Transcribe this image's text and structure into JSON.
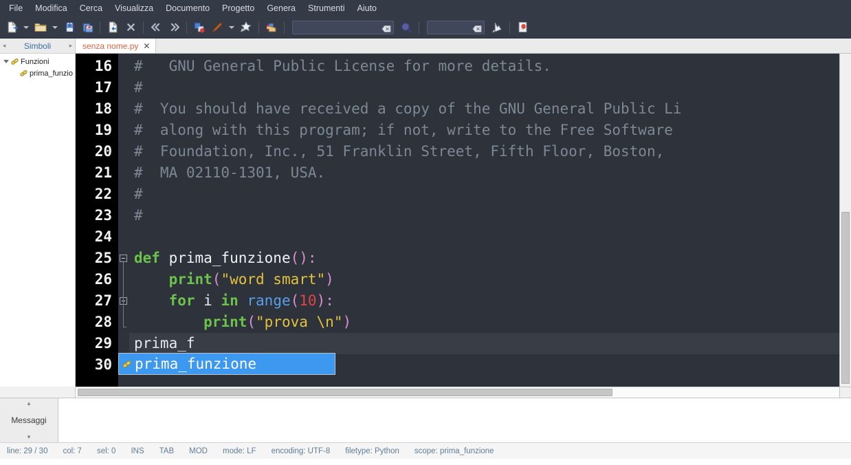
{
  "menubar": {
    "items": [
      {
        "label": "File",
        "name": "menu-file"
      },
      {
        "label": "Modifica",
        "name": "menu-modifica"
      },
      {
        "label": "Cerca",
        "name": "menu-cerca"
      },
      {
        "label": "Visualizza",
        "name": "menu-visualizza"
      },
      {
        "label": "Documento",
        "name": "menu-documento"
      },
      {
        "label": "Progetto",
        "name": "menu-progetto"
      },
      {
        "label": "Genera",
        "name": "menu-genera"
      },
      {
        "label": "Strumenti",
        "name": "menu-strumenti"
      },
      {
        "label": "Aiuto",
        "name": "menu-aiuto"
      }
    ]
  },
  "toolbar": {
    "buttons": [
      {
        "name": "new-file-icon",
        "glyph": "new"
      },
      {
        "name": "new-file-dropdown-icon",
        "glyph": "caret"
      },
      {
        "name": "open-folder-icon",
        "glyph": "folder"
      },
      {
        "name": "open-recent-dropdown-icon",
        "glyph": "caret"
      },
      {
        "name": "save-icon",
        "glyph": "save"
      },
      {
        "name": "save-all-icon",
        "glyph": "saveall"
      },
      {
        "name": "separator",
        "glyph": "sep"
      },
      {
        "name": "reload-file-icon",
        "glyph": "reload"
      },
      {
        "name": "close-file-icon",
        "glyph": "close"
      },
      {
        "name": "separator",
        "glyph": "sep"
      },
      {
        "name": "navigate-back-icon",
        "glyph": "back"
      },
      {
        "name": "navigate-forward-icon",
        "glyph": "forward"
      },
      {
        "name": "separator",
        "glyph": "sep"
      },
      {
        "name": "compile-icon",
        "glyph": "compile"
      },
      {
        "name": "build-icon",
        "glyph": "build"
      },
      {
        "name": "build-dropdown-icon",
        "glyph": "caret"
      },
      {
        "name": "run-icon",
        "glyph": "run"
      },
      {
        "name": "separator",
        "glyph": "sep"
      },
      {
        "name": "color-scheme-icon",
        "glyph": "colors"
      },
      {
        "name": "separator",
        "glyph": "sep"
      }
    ],
    "search": {
      "value": "",
      "placeholder": ""
    },
    "goto": {
      "value": "",
      "placeholder": ""
    },
    "search_icon_name": "search-magnifier-icon",
    "jump-to-icon": "jump-to-icon",
    "quit-icon": "quit-icon"
  },
  "sidebar": {
    "tab_label": "Simboli",
    "nav_prev": "◂",
    "nav_next": "▸",
    "tree": [
      {
        "label": "Funzioni",
        "level": 0,
        "expanded": true,
        "name": "tree-item-funzioni"
      },
      {
        "label": "prima_funzio",
        "level": 1,
        "expanded": false,
        "name": "tree-item-prima-funzione"
      }
    ]
  },
  "editor": {
    "tab": {
      "filename": "senza nome.py",
      "close": "✕",
      "modified_color": "#e8603c"
    },
    "lines": [
      {
        "num": "16",
        "tokens": [
          {
            "t": "#   GNU General Public License for more details.",
            "c": "cm"
          }
        ]
      },
      {
        "num": "17",
        "tokens": [
          {
            "t": "#",
            "c": "cm"
          }
        ]
      },
      {
        "num": "18",
        "tokens": [
          {
            "t": "#  You should have received a copy of the GNU General Public Li",
            "c": "cm"
          }
        ]
      },
      {
        "num": "19",
        "tokens": [
          {
            "t": "#  along with this program; if not, write to the Free Software",
            "c": "cm"
          }
        ]
      },
      {
        "num": "20",
        "tokens": [
          {
            "t": "#  Foundation, Inc., 51 Franklin Street, Fifth Floor, Boston,",
            "c": "cm"
          }
        ]
      },
      {
        "num": "21",
        "tokens": [
          {
            "t": "#  MA 02110-1301, USA.",
            "c": "cm"
          }
        ]
      },
      {
        "num": "22",
        "tokens": [
          {
            "t": "#",
            "c": "cm"
          }
        ]
      },
      {
        "num": "23",
        "tokens": [
          {
            "t": "#",
            "c": "cm"
          }
        ]
      },
      {
        "num": "24",
        "tokens": []
      },
      {
        "num": "25",
        "fold": "open",
        "tokens": [
          {
            "t": "def ",
            "c": "kw"
          },
          {
            "t": "prima_funzione",
            "c": "fnname"
          },
          {
            "t": "():",
            "c": "paren"
          }
        ]
      },
      {
        "num": "26",
        "tokens": [
          {
            "t": "    ",
            "c": "plain"
          },
          {
            "t": "print",
            "c": "kw"
          },
          {
            "t": "(",
            "c": "paren"
          },
          {
            "t": "\"word smart\"",
            "c": "str"
          },
          {
            "t": ")",
            "c": "paren"
          }
        ]
      },
      {
        "num": "27",
        "fold": "open",
        "tokens": [
          {
            "t": "    ",
            "c": "plain"
          },
          {
            "t": "for ",
            "c": "kw"
          },
          {
            "t": "i ",
            "c": "plain"
          },
          {
            "t": "in ",
            "c": "kw"
          },
          {
            "t": "range",
            "c": "bi"
          },
          {
            "t": "(",
            "c": "paren"
          },
          {
            "t": "10",
            "c": "num"
          },
          {
            "t": "):",
            "c": "paren"
          }
        ]
      },
      {
        "num": "28",
        "tokens": [
          {
            "t": "        ",
            "c": "plain"
          },
          {
            "t": "print",
            "c": "kw"
          },
          {
            "t": "(",
            "c": "paren"
          },
          {
            "t": "\"prova \\n\"",
            "c": "str"
          },
          {
            "t": ")",
            "c": "paren"
          }
        ]
      },
      {
        "num": "29",
        "current": true,
        "tokens": [
          {
            "t": "prima_f",
            "c": "plain"
          }
        ]
      },
      {
        "num": "30",
        "tokens": []
      }
    ],
    "autocomplete": {
      "visible": true,
      "selected": "prima_funzione",
      "icon_name": "function-symbol-icon",
      "bg": "#3d98f0"
    }
  },
  "bottom_panel": {
    "tab_label": "Messaggi",
    "arrow_up": "▴",
    "arrow_down": "▾",
    "content": ""
  },
  "statusbar": {
    "items": [
      {
        "label": "line: 29 / 30",
        "name": "status-line"
      },
      {
        "label": "col: 7",
        "name": "status-col"
      },
      {
        "label": "sel: 0",
        "name": "status-sel"
      },
      {
        "label": "INS",
        "name": "status-insert-mode"
      },
      {
        "label": "TAB",
        "name": "status-tab-mode"
      },
      {
        "label": "MOD",
        "name": "status-modified"
      },
      {
        "label": "mode: LF",
        "name": "status-eol-mode"
      },
      {
        "label": "encoding: UTF-8",
        "name": "status-encoding"
      },
      {
        "label": "filetype: Python",
        "name": "status-filetype"
      },
      {
        "label": "scope: prima_funzione",
        "name": "status-scope"
      }
    ]
  }
}
